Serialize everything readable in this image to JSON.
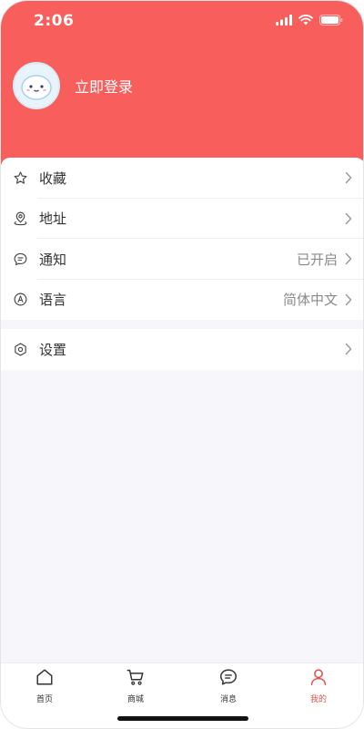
{
  "status_bar": {
    "time": "2:06"
  },
  "profile": {
    "login_label": "立即登录"
  },
  "menu": {
    "items": [
      {
        "label": "收藏",
        "value": ""
      },
      {
        "label": "地址",
        "value": ""
      },
      {
        "label": "通知",
        "value": "已开启"
      },
      {
        "label": "语言",
        "value": "简体中文"
      }
    ],
    "settings": {
      "label": "设置"
    }
  },
  "tabbar": {
    "tabs": [
      {
        "label": "首页",
        "icon": "home-icon"
      },
      {
        "label": "商城",
        "icon": "cart-icon"
      },
      {
        "label": "消息",
        "icon": "message-icon"
      },
      {
        "label": "我的",
        "icon": "user-icon"
      }
    ],
    "active_tab": "我的"
  },
  "colors": {
    "header": "#f75e5c",
    "active_tab": "#e0504e",
    "page_background": "#f7f6fa"
  }
}
